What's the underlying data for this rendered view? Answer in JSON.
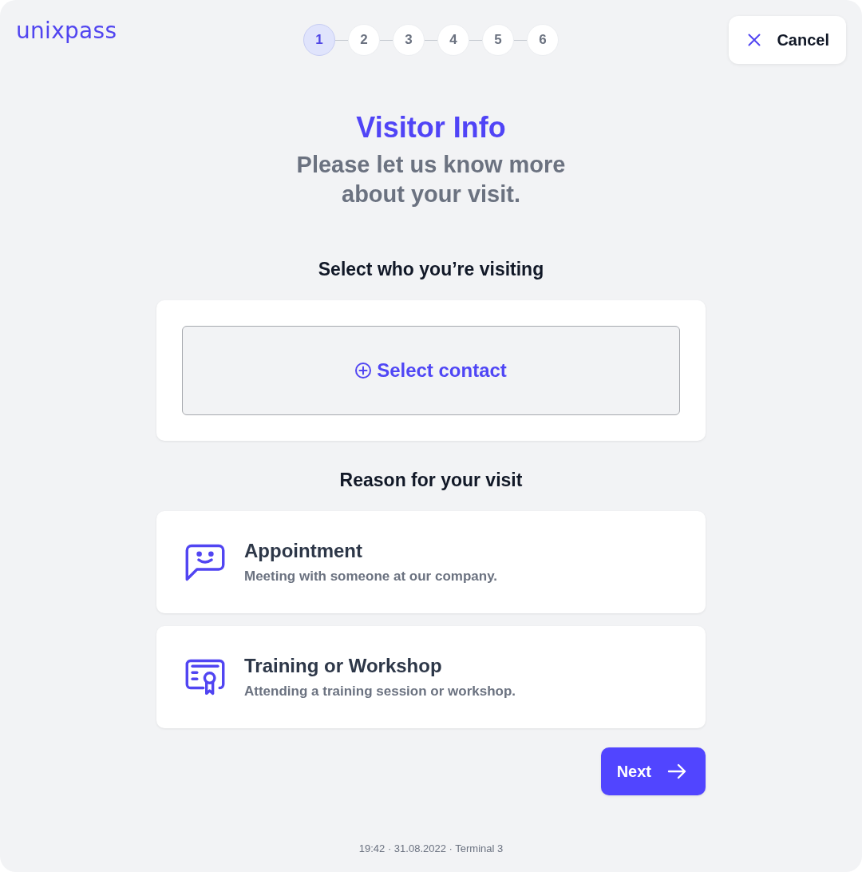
{
  "header": {
    "logo": "unixpass",
    "steps": [
      {
        "label": "1",
        "selected": true
      },
      {
        "label": "2",
        "selected": false
      },
      {
        "label": "3",
        "selected": false
      },
      {
        "label": "4",
        "selected": false
      },
      {
        "label": "5",
        "selected": false
      },
      {
        "label": "6",
        "selected": false
      }
    ],
    "cancel_button": "Cancel"
  },
  "heading": {
    "title": "Visitor Info",
    "subtitle": "Please let us know more about your visit."
  },
  "contact_section": {
    "label": "Select who you’re visiting",
    "select_button": "Select contact"
  },
  "reason_section": {
    "label": "Reason for your visit",
    "options": [
      {
        "kind": "appointment",
        "title": "Appointment",
        "description": "Meeting with someone at our company.",
        "selected": false
      },
      {
        "kind": "training",
        "title": "Training or Workshop",
        "description": "Attending a training session or workshop.",
        "selected": false
      }
    ]
  },
  "next_button": "Next",
  "footer": "19:42 · 31.08.2022 · Terminal 3"
}
